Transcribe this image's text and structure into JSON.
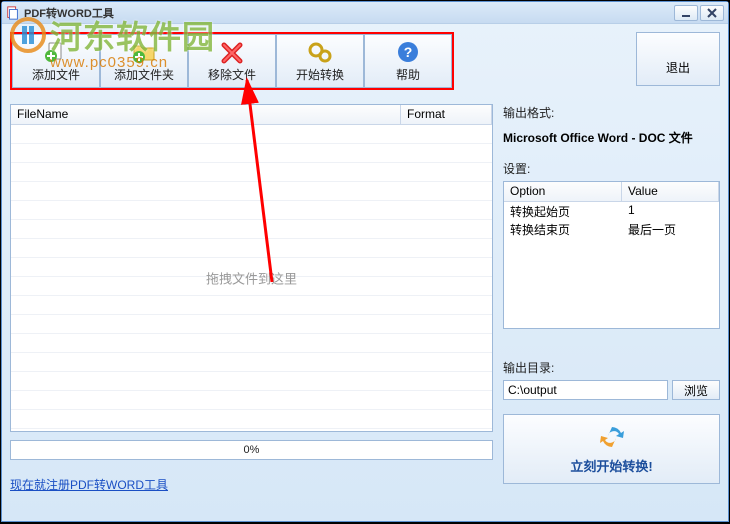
{
  "window": {
    "title": "PDF转WORD工具"
  },
  "toolbar": {
    "add_file": "添加文件",
    "add_folder": "添加文件夹",
    "remove": "移除文件",
    "start": "开始转换",
    "help": "帮助"
  },
  "exit_label": "退出",
  "file_table": {
    "col_name": "FileName",
    "col_format": "Format",
    "drag_hint": "拖拽文件到这里"
  },
  "progress_pct": "0%",
  "register_link": "现在就注册PDF转WORD工具",
  "right": {
    "out_format_label": "输出格式:",
    "out_format_value": "Microsoft Office Word - DOC 文件",
    "settings_label": "设置:",
    "settings_cols": {
      "option": "Option",
      "value": "Value"
    },
    "settings_rows": [
      {
        "option": "转换起始页",
        "value": "1"
      },
      {
        "option": "转换结束页",
        "value": "最后一页"
      }
    ],
    "out_dir_label": "输出目录:",
    "out_dir_value": "C:\\output",
    "browse_label": "浏览",
    "start_now_label": "立刻开始转换!"
  },
  "watermark": {
    "brand": "河东软件园",
    "url": "www.pc0359.cn"
  }
}
